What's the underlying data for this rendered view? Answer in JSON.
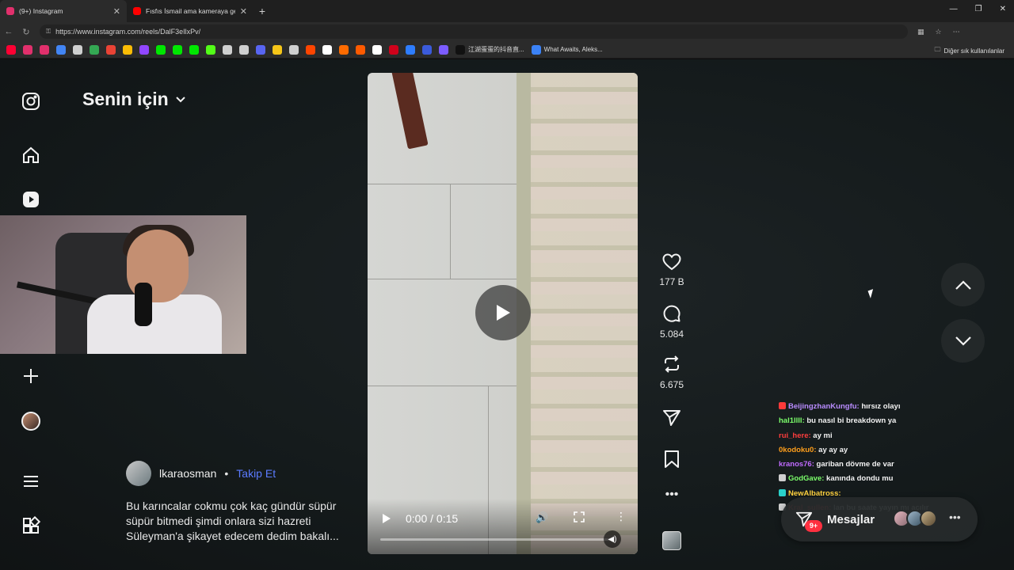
{
  "browser": {
    "tabs": [
      {
        "title": "(9+) Instagram",
        "color": "#e1306c",
        "active": true
      },
      {
        "title": "Fısfıs İsmail ama kameraya gereksiz",
        "color": "#ff0000",
        "active": false
      }
    ],
    "new_tab": "+",
    "window_controls": [
      "—",
      "❐",
      "✕"
    ],
    "url": "https://www.instagram.com/reels/DalF3eIlxPv/",
    "bookmarks": {
      "icon_colors": [
        "#ff0033",
        "#e1306c",
        "#e1306c",
        "#4285f4",
        "#cfcfcf",
        "#34a853",
        "#ea4335",
        "#fbbc05",
        "#9146ff",
        "#00e701",
        "#00e701",
        "#00e701",
        "#53fc18",
        "#cfcfcf",
        "#cfcfcf",
        "#5865f2",
        "#f5c518",
        "#cfcfcf",
        "#ff4500",
        "#ffffff",
        "#ff6b00",
        "#ff5a00",
        "#ffffff",
        "#d0021b",
        "#2e7dff",
        "#3b5bdb",
        "#7c5cff"
      ],
      "labels": [
        "江湖蛋蛋的抖音直...",
        "What Awaits, Aleks..."
      ],
      "folder": "Diğer sık kullanılanlar"
    }
  },
  "feed": {
    "title": "Senin için"
  },
  "sidebar": {
    "items": [
      "instagram-logo-icon",
      "home-icon",
      "reels-icon",
      "create-icon",
      "profile-avatar",
      "menu-icon",
      "more-icon"
    ]
  },
  "post": {
    "author": "lkaraosman",
    "separator": "•",
    "follow": "Takip Et",
    "caption": "Bu karıncalar cokmu çok kaç gündür süpür süpür bitmedi şimdi onlara sizi hazreti Süleyman'a şikayet edecem dedim bakalı..."
  },
  "video": {
    "time": "0:00 / 0:15",
    "progress": 0.0
  },
  "actions": {
    "likes": "177 B",
    "comments": "5.084",
    "reposts": "6.675"
  },
  "chat": [
    {
      "user": "BeijingzhanKungfu:",
      "msg": "hırsız olayı",
      "color": "#b98cff",
      "badge": "#ff3a3a"
    },
    {
      "user": "hal1llll:",
      "msg": "bu nasıl bi breakdown ya",
      "color": "#7cff6b",
      "badge": ""
    },
    {
      "user": "rui_here:",
      "msg": "ay mi",
      "color": "#ff3d3d",
      "badge": ""
    },
    {
      "user": "0kodoku0:",
      "msg": "ay ay ay",
      "color": "#ff9f1c",
      "badge": ""
    },
    {
      "user": "kranos76:",
      "msg": "gariban dövme de var",
      "color": "#c06bff",
      "badge": ""
    },
    {
      "user": "GodGave:",
      "msg": "kanında dondu mu",
      "color": "#7cff6b",
      "badge": "#cfcfcf"
    },
    {
      "user": "NewAlbatross:",
      "msg": "",
      "color": "#ffd23f",
      "badge": "#2ad1c9"
    },
    {
      "user": "Kral_sullen:",
      "msg": "lan bu saate yayın mı açılır",
      "color": "#ff3d3d",
      "badge": "#cfcfcf"
    }
  ],
  "messages": {
    "label": "Mesajlar",
    "badge": "9+"
  }
}
